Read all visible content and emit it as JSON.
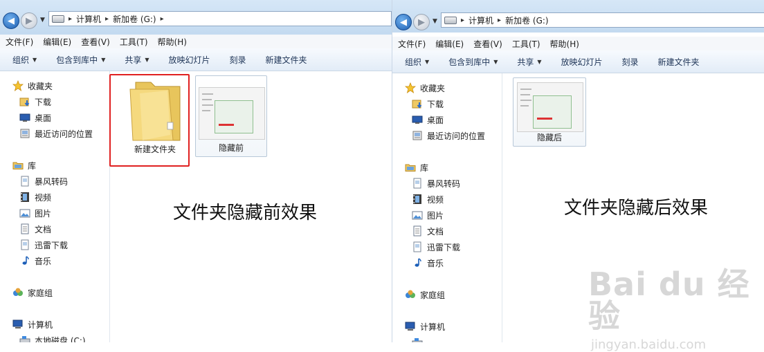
{
  "left": {
    "breadcrumb": {
      "computer": "计算机",
      "sep": "▸",
      "drive": "新加卷 (G:)"
    },
    "menu": [
      "文件(F)",
      "编辑(E)",
      "查看(V)",
      "工具(T)",
      "帮助(H)"
    ],
    "toolbar": [
      "组织",
      "包含到库中",
      "共享",
      "放映幻灯片",
      "刻录",
      "新建文件夹"
    ],
    "sidebar": {
      "favorites": "收藏夹",
      "downloads": "下载",
      "desktop": "桌面",
      "recent": "最近访问的位置",
      "libraries": "库",
      "baofeng": "暴风转码",
      "videos": "视频",
      "pictures": "图片",
      "documents": "文档",
      "xunlei": "迅雷下载",
      "music": "音乐",
      "homegroup": "家庭组",
      "computer": "计算机",
      "local_disk": "本地磁盘 (C:)"
    },
    "files": [
      "新建文件夹",
      "隐藏前"
    ],
    "caption": "文件夹隐藏前效果"
  },
  "right": {
    "breadcrumb": {
      "computer": "计算机",
      "sep": "▸",
      "drive": "新加卷 (G:)"
    },
    "menu": [
      "文件(F)",
      "编辑(E)",
      "查看(V)",
      "工具(T)",
      "帮助(H)"
    ],
    "toolbar": [
      "组织",
      "包含到库中",
      "共享",
      "放映幻灯片",
      "刻录",
      "新建文件夹"
    ],
    "sidebar": {
      "favorites": "收藏夹",
      "downloads": "下载",
      "desktop": "桌面",
      "recent": "最近访问的位置",
      "libraries": "库",
      "baofeng": "暴风转码",
      "videos": "视频",
      "pictures": "图片",
      "documents": "文档",
      "xunlei": "迅雷下载",
      "music": "音乐",
      "homegroup": "家庭组",
      "computer": "计算机"
    },
    "files": [
      "隐藏后"
    ],
    "caption": "文件夹隐藏后效果"
  },
  "watermark": {
    "brand": "Bai du 经验",
    "url": "jingyan.baidu.com"
  },
  "colors": {
    "highlight": "#e02020",
    "toolbar_text": "#1e3457",
    "address_gradient": "#c3daf0"
  }
}
